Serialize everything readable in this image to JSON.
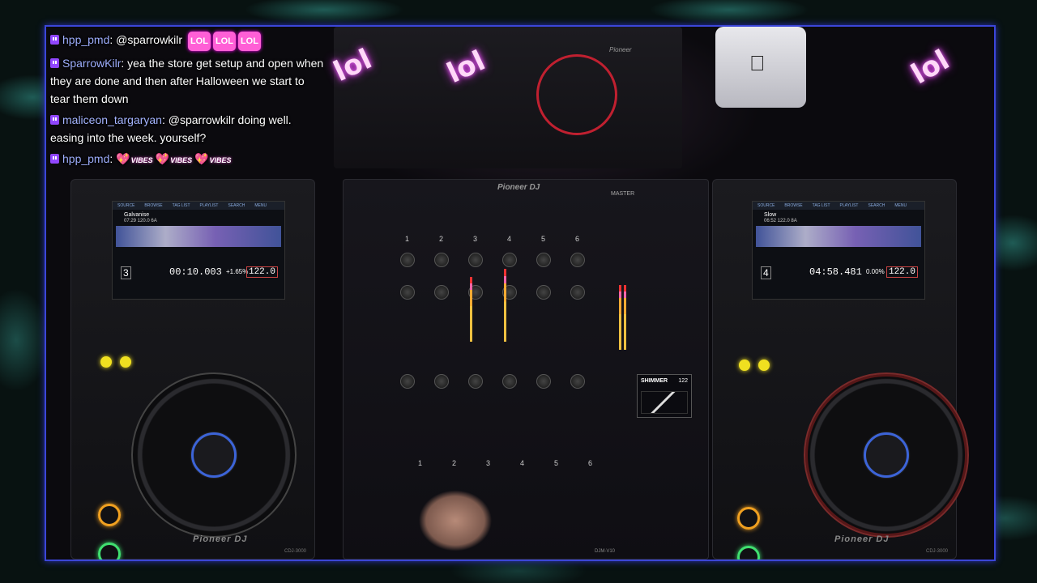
{
  "chat": {
    "messages": [
      {
        "user": "hpp_pmd",
        "text": "@sparrowkilr",
        "emotes": [
          "LOL",
          "LOL",
          "LOL"
        ]
      },
      {
        "user": "SparrowKilr",
        "text": "yea the store get setup and open when they are done and then after Halloween we start to tear them down"
      },
      {
        "user": "maliceon_targaryan",
        "text": "@sparrowkilr doing well. easing into the week. yourself?"
      },
      {
        "user": "hpp_pmd",
        "text": "",
        "emotes": [
          "VIBES",
          "VIBES",
          "VIBES"
        ]
      }
    ],
    "separator": ":"
  },
  "stickers": {
    "lol1": "lol",
    "lol2": "lol",
    "lol3": "lol"
  },
  "left_deck": {
    "brand": "Pioneer DJ",
    "model": "CDJ-3000",
    "track": "Galvanise",
    "track_info": "07:29  120.0  6A",
    "time": "00:10.003",
    "tempo_pct": "+1.65%",
    "bpm": "122.0",
    "deck_num": "3",
    "tabs": [
      "SOURCE",
      "BROWSE",
      "TAG LIST",
      "PLAYLIST",
      "SEARCH",
      "MENU"
    ]
  },
  "right_deck": {
    "brand": "Pioneer DJ",
    "model": "CDJ-3000",
    "track": "Slow",
    "track_info": "06:52  122.0  8A",
    "time": "04:58.481",
    "tempo_pct": "0.00%",
    "bpm": "122.0",
    "deck_num": "4",
    "tabs": [
      "SOURCE",
      "BROWSE",
      "TAG LIST",
      "PLAYLIST",
      "SEARCH",
      "MENU"
    ]
  },
  "mixer": {
    "brand": "Pioneer DJ",
    "model": "DJM-V10",
    "channels": [
      "1",
      "2",
      "3",
      "4",
      "5",
      "6"
    ],
    "fader_labels": [
      "1",
      "2",
      "3",
      "4",
      "5",
      "6"
    ],
    "master_label": "MASTER",
    "beat_fx": {
      "name": "SHIMMER",
      "value": "122"
    }
  },
  "rmx": {
    "brand": "Pioneer"
  },
  "colors": {
    "frame": "#3b46d8",
    "lol_glow": "#f060ff",
    "twitch": "#9146ff"
  }
}
